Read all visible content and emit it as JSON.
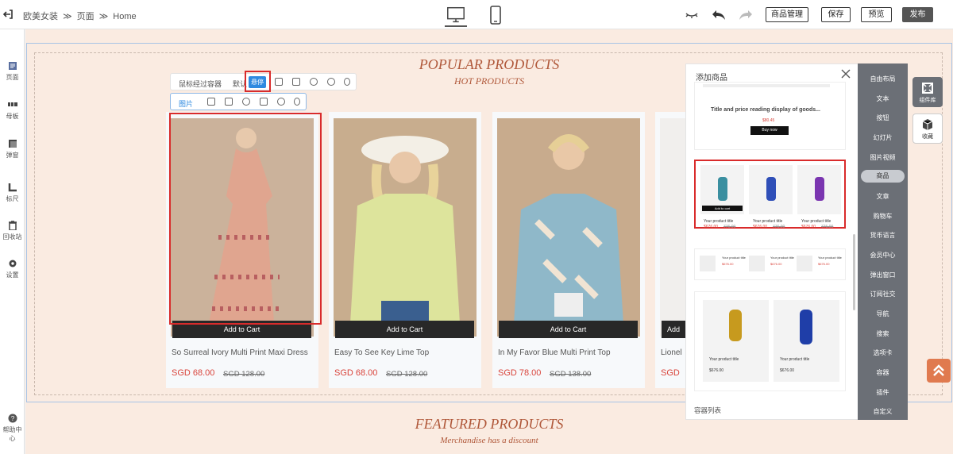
{
  "breadcrumb": {
    "a": "欧美女装",
    "sep1": "≫",
    "b": "页面",
    "sep2": "≫",
    "c": "Home"
  },
  "toolbar": {
    "goods_mgmt": "商品管理",
    "save": "保存",
    "preview": "预览",
    "publish": "发布"
  },
  "leftbar": [
    {
      "label": "页面",
      "icon": "page-icon"
    },
    {
      "label": "母板",
      "icon": "template-icon"
    },
    {
      "label": "弹窗",
      "icon": "popup-icon"
    },
    {
      "label": "标尺",
      "icon": "ruler-icon"
    },
    {
      "label": "回收站",
      "icon": "trash-icon"
    },
    {
      "label": "设置",
      "icon": "gear-icon"
    },
    {
      "label": "帮助中心",
      "icon": "help-icon"
    }
  ],
  "section": {
    "title": "POPULAR PRODUCTS",
    "subtitle": "HOT PRODUCTS",
    "next_title": "FEATURED PRODUCTS",
    "next_subtitle": "Merchandise has a discount"
  },
  "float1": {
    "label": "鼠标经过容器",
    "default": "默认",
    "hover": "悬停"
  },
  "float2": {
    "label": "图片"
  },
  "products": [
    {
      "name": "So Surreal Ivory Multi Print Maxi Dress",
      "price": "SGD 68.00",
      "old": "SGD 128.00",
      "cart": "Add to Cart"
    },
    {
      "name": "Easy To See Key Lime Top",
      "price": "SGD 68.00",
      "old": "SGD 128.00",
      "cart": "Add to Cart"
    },
    {
      "name": "In My Favor Blue Multi Print Top",
      "price": "SGD 78.00",
      "old": "SGD 138.00",
      "cart": "Add to Cart"
    },
    {
      "name": "Lionel",
      "price": "SGD",
      "old": "",
      "cart": "Add"
    }
  ],
  "panel": {
    "title": "添加商品",
    "preview_text": "Title and price reading display of goods...",
    "preview_price": "$80.45",
    "preview_btn": "Buy now",
    "item_title": "Your product title",
    "item_price": "$676.00",
    "item_old": "776.00",
    "add_to_cart": "Add to cart",
    "footer": "容器列表"
  },
  "rnav": [
    "自由布局",
    "文本",
    "按钮",
    "幻灯片",
    "图片视频",
    "商品",
    "文章",
    "购物车",
    "货币语言",
    "会员中心",
    "弹出窗口",
    "订阅社交",
    "导航",
    "搜索",
    "选项卡",
    "容器",
    "插件",
    "自定义"
  ],
  "rtools": {
    "lib": "组件库",
    "fav": "收藏"
  },
  "colors": {
    "accent": "#b0583a",
    "price": "#d9443b",
    "highlight": "#d92b2b",
    "blue": "#2f8ae0"
  }
}
